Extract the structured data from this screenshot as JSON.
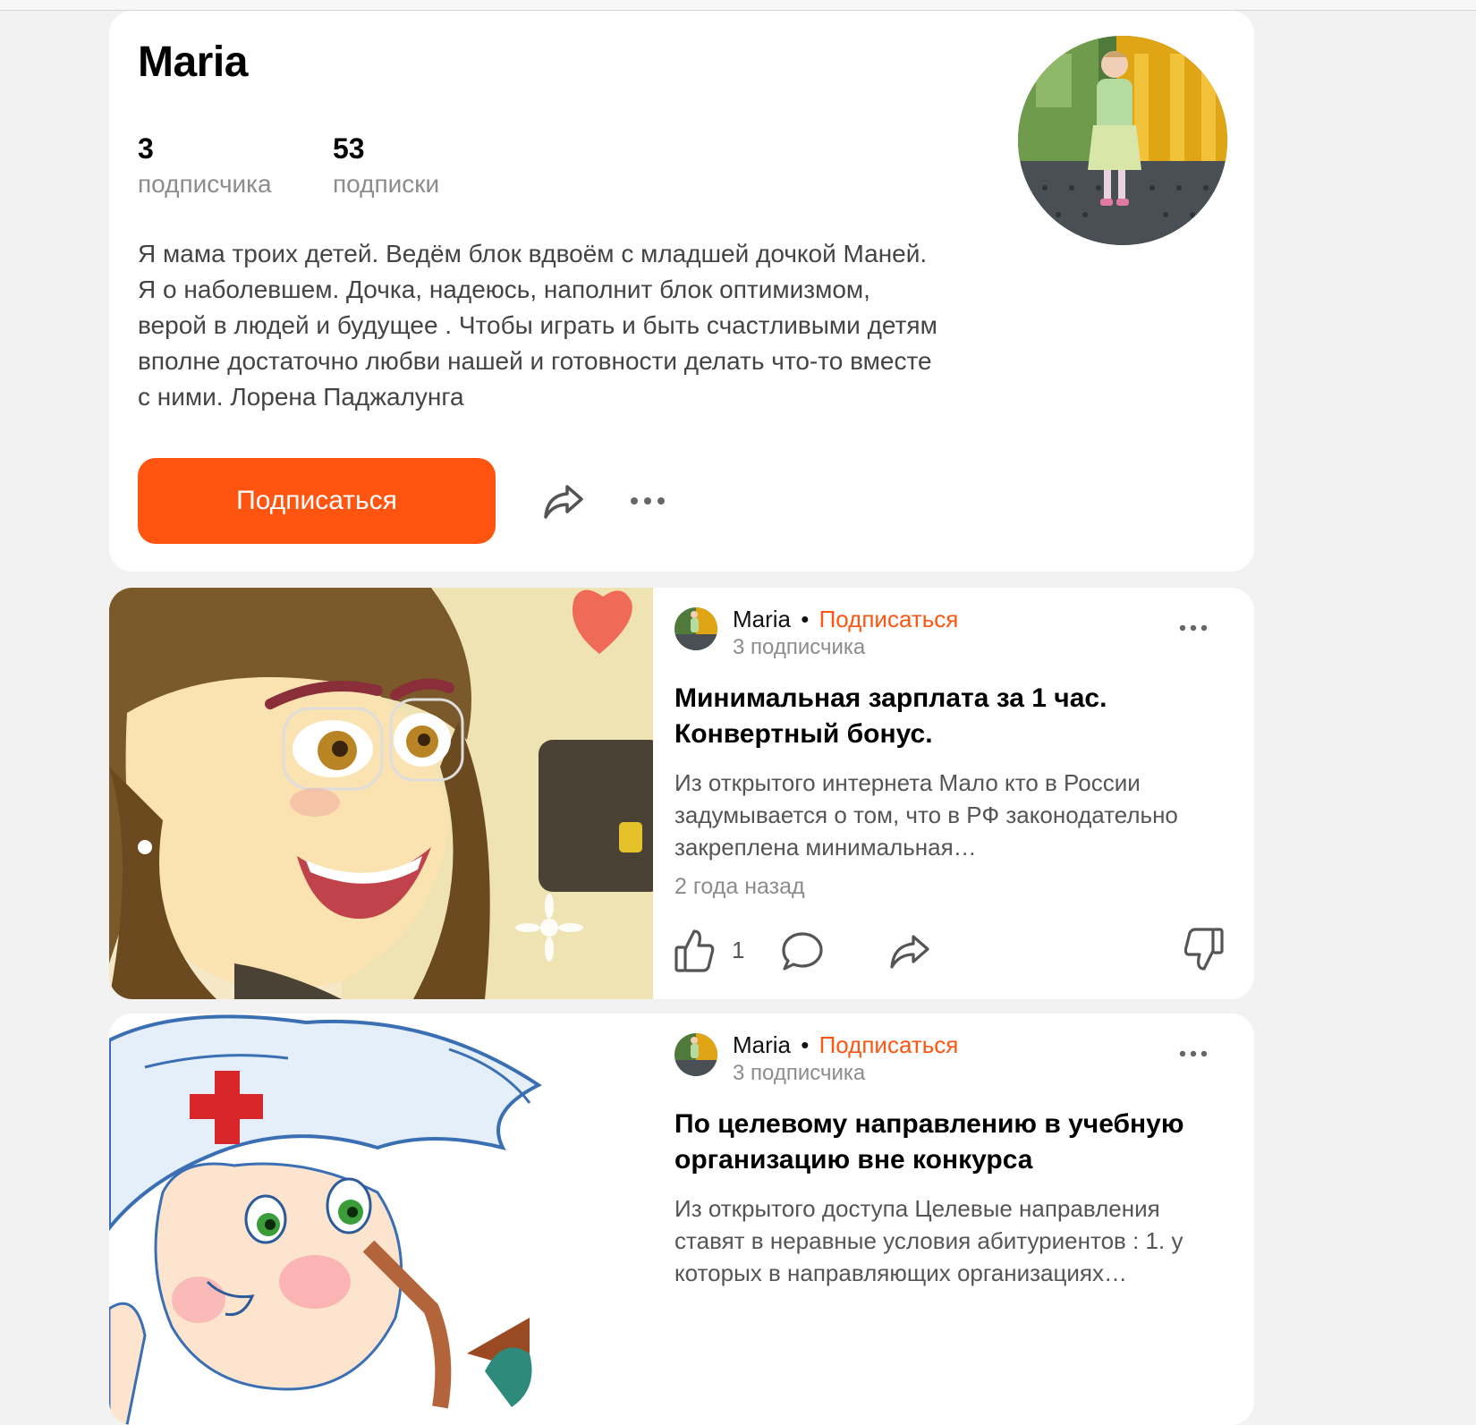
{
  "profile": {
    "name": "Maria",
    "followers_count": "3",
    "followers_label": "подписчика",
    "following_count": "53",
    "following_label": "подписки",
    "bio": "Я мама троих детей. Ведём блок вдвоём с младшей дочкой Маней. Я о наболевшем. Дочка, надеюсь, наполнит блок оптимизмом, верой в людей и будущее . Чтобы играть и быть счастливыми детям вполне достаточно любви нашей и готовности делать что-то вместе с ними. Лорена Паджалунга",
    "subscribe_label": "Подписаться",
    "share_icon": "share-arrow-icon",
    "more_icon": "more-dots-icon"
  },
  "articles": [
    {
      "author": "Maria",
      "separator": "•",
      "subscribe_label": "Подписаться",
      "followers": "3 подписчика",
      "title": "Минимальная зарплата за 1 час. Конвертный бонус.",
      "excerpt": "Из открытого интернета Мало кто в России задумывается о том, что в РФ законодательно закреплена минимальная…",
      "date": "2 года назад",
      "likes": "1",
      "cover": "cartoon woman with glasses and briefcase"
    },
    {
      "author": "Maria",
      "separator": "•",
      "subscribe_label": "Подписаться",
      "followers": "3 подписчика",
      "title": "По целевому направлению в учебную организацию вне конкурса",
      "excerpt": "Из открытого доступа Целевые направления ставят в неравные условия абитуриентов : 1. у которых в направляющих организациях…",
      "cover": "cartoon nurse girl with red cross cap"
    }
  ],
  "colors": {
    "accent": "#ff5511",
    "background": "#f2f2f2",
    "card": "#ffffff",
    "muted_text": "#8c8c8c"
  }
}
